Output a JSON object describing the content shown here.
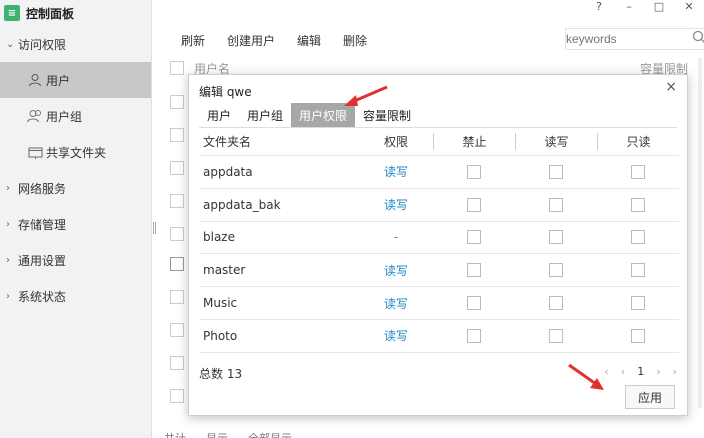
{
  "app": {
    "title": "控制面板",
    "logo_glyph": "≡"
  },
  "window": {
    "help": "?",
    "minimize": "–",
    "maximize": "□",
    "close": "✕"
  },
  "sidebar": {
    "sections": [
      {
        "label": "访问权限",
        "expanded": true
      },
      {
        "label": "网络服务"
      },
      {
        "label": "存储管理"
      },
      {
        "label": "通用设置"
      },
      {
        "label": "系统状态"
      }
    ],
    "sub_items": [
      {
        "label": "用户",
        "icon": "user-icon",
        "active": true
      },
      {
        "label": "用户组",
        "icon": "user-group-icon"
      },
      {
        "label": "共享文件夹",
        "icon": "folder-icon"
      }
    ]
  },
  "toolbar": {
    "refresh": "刷新",
    "create_user": "创建用户",
    "edit": "编辑",
    "delete": "删除",
    "search_placeholder": "keywords"
  },
  "bg_table": {
    "col_username": "用户名",
    "col_quota": "容量限制"
  },
  "bg_footer": {
    "a": "共计",
    "b": "显示",
    "c": "全部显示"
  },
  "modal": {
    "title": "编辑 qwe",
    "close": "×",
    "tabs": [
      "用户",
      "用户组",
      "用户权限",
      "容量限制"
    ],
    "active_tab": 2,
    "columns": {
      "name": "文件夹名",
      "perm": "权限",
      "deny": "禁止",
      "rw": "读写",
      "ro": "只读"
    },
    "rows": [
      {
        "name": "appdata",
        "perm": "读写"
      },
      {
        "name": "appdata_bak",
        "perm": "读写"
      },
      {
        "name": "blaze",
        "perm": "-"
      },
      {
        "name": "master",
        "perm": "读写"
      },
      {
        "name": "Music",
        "perm": "读写"
      },
      {
        "name": "Photo",
        "perm": "读写"
      }
    ],
    "total": "总数 13",
    "pager": {
      "first": "‹",
      "prev": "‹",
      "page": "1",
      "next": "›",
      "last": "›"
    },
    "apply": "应用"
  },
  "colors": {
    "accent": "#1a86c8",
    "active_tab": "#a7a7a7",
    "sidebar_active": "#c8c8c8",
    "arrow": "#e03030"
  }
}
